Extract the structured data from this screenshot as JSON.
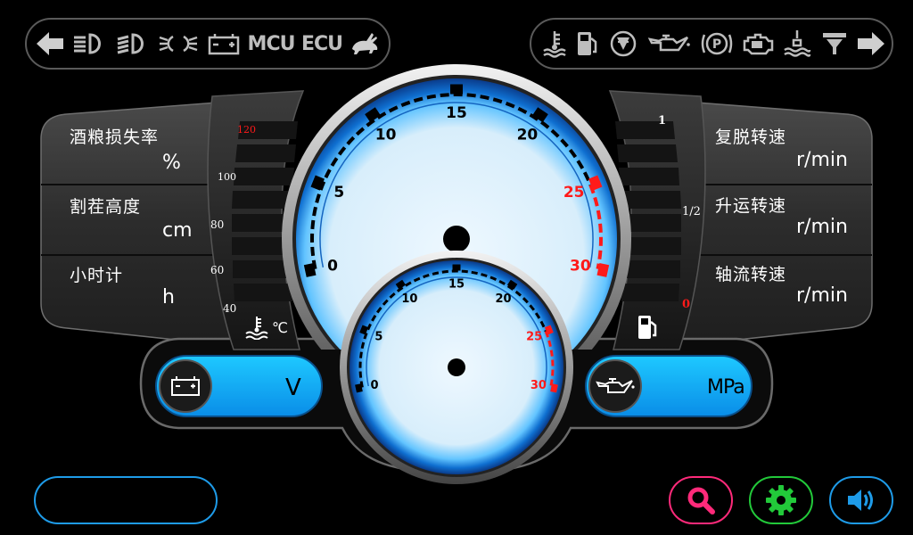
{
  "indicators_left": {
    "items": [
      "left-turn-arrow",
      "headlight-high",
      "headlight-low",
      "position-lights",
      "battery",
      "mcu-label",
      "ecu-label",
      "rabbit-fast"
    ],
    "mcu": "MCU",
    "ecu": "ECU"
  },
  "indicators_right": {
    "items": [
      "coolant-temp",
      "fuel",
      "fan-filter",
      "oil-can",
      "parking-brake",
      "engine",
      "water-in-fuel",
      "air-filter",
      "right-turn-arrow"
    ]
  },
  "left_panel": {
    "rows": [
      {
        "label": "酒粮损失率",
        "unit": "%"
      },
      {
        "label": "割茬高度",
        "unit": "cm"
      },
      {
        "label": "小时计",
        "unit": "h"
      }
    ]
  },
  "right_panel": {
    "rows": [
      {
        "label": "复脱转速",
        "unit": "r/min"
      },
      {
        "label": "升运转速",
        "unit": "r/min"
      },
      {
        "label": "轴流转速",
        "unit": "r/min"
      }
    ]
  },
  "temp_gauge": {
    "ticks": [
      "120",
      "100",
      "80",
      "60",
      "40"
    ],
    "unit": "℃"
  },
  "fuel_gauge": {
    "ticks": [
      "1",
      "1/2",
      "0"
    ]
  },
  "main_dial": {
    "ticks": [
      "0",
      "5",
      "10",
      "15",
      "20",
      "25",
      "30"
    ],
    "redline_from": 25
  },
  "sub_dial": {
    "ticks": [
      "0",
      "5",
      "10",
      "15",
      "20",
      "25",
      "30"
    ],
    "redline_from": 25
  },
  "voltage": {
    "unit": "V"
  },
  "oil_pressure": {
    "unit": "MPa"
  },
  "colors": {
    "accent_blue": "#1aa8ff",
    "red": "#ff1a1a",
    "search_pink": "#ff2a7a",
    "settings_green": "#22c93a",
    "volume_blue": "#1e9be8"
  },
  "bottom_buttons": [
    "search-icon",
    "gear-icon",
    "volume-icon"
  ]
}
